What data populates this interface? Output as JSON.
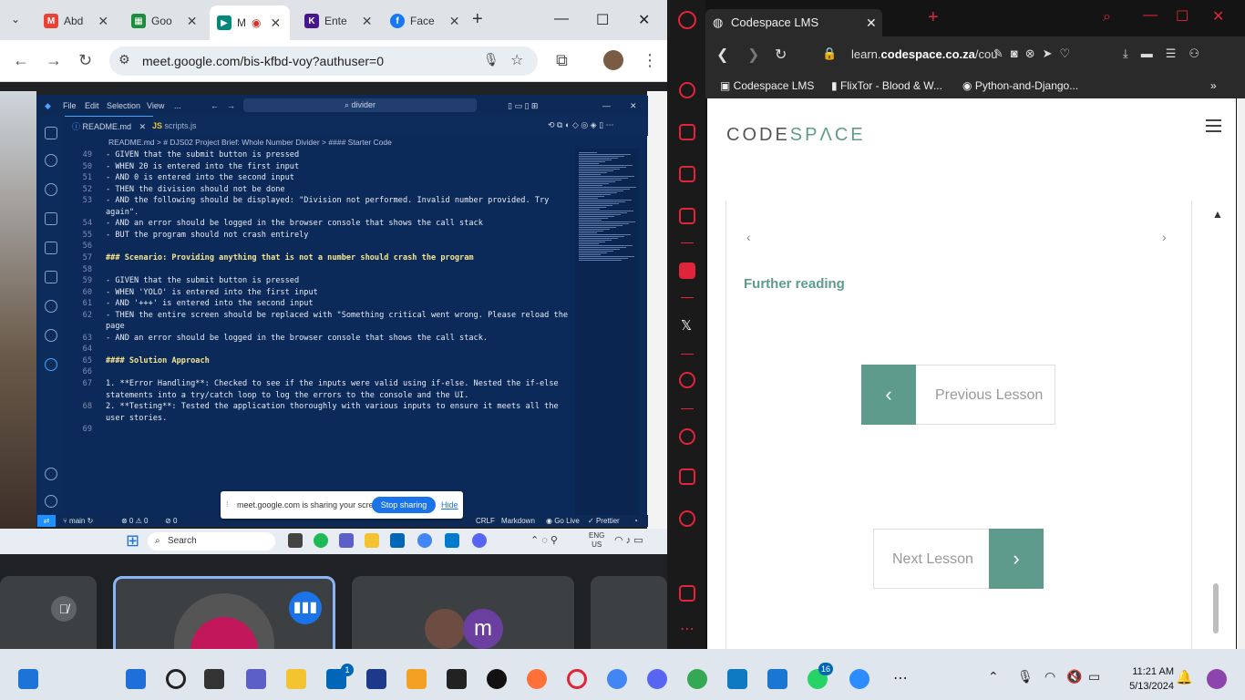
{
  "chrome": {
    "tabs": [
      {
        "label": "Abd",
        "icon": "gmail-icon",
        "color": "#ea4335"
      },
      {
        "label": "Goo",
        "icon": "google-sheets-icon",
        "color": "#1e8e3e"
      },
      {
        "label": "M",
        "icon": "google-meet-icon",
        "color": "#00897b"
      },
      {
        "label": "Ente",
        "icon": "kahoot-icon",
        "color": "#46178f"
      },
      {
        "label": "Face",
        "icon": "facebook-icon",
        "color": "#1877f2"
      }
    ],
    "url": "meet.google.com/bis-kfbd-voy?authuser=0"
  },
  "vscode": {
    "menu": [
      "File",
      "Edit",
      "Selection",
      "View",
      "..."
    ],
    "search": "divider",
    "tabs": [
      {
        "label": "README.md"
      },
      {
        "label": "scripts.js"
      }
    ],
    "breadcrumb": "README.md > # DJS02 Project Brief: Whole Number Divider > #### Starter Code",
    "lines": [
      {
        "n": "49",
        "text": "- GIVEN that the submit button is pressed",
        "h": false
      },
      {
        "n": "50",
        "text": "- WHEN 20 is entered into the first input",
        "h": false
      },
      {
        "n": "51",
        "text": "- AND 0 is entered into the second input",
        "h": false
      },
      {
        "n": "52",
        "text": "- THEN the division should not be done",
        "h": false
      },
      {
        "n": "53",
        "text": "- AND the following should be displayed: \"Division not performed. Invalid number provided. Try",
        "h": false
      },
      {
        "n": "",
        "text": "again\".",
        "h": false
      },
      {
        "n": "54",
        "text": "- AND an error should be logged in the browser console that shows the call stack",
        "h": false
      },
      {
        "n": "55",
        "text": "- BUT the program should not crash entirely",
        "h": false
      },
      {
        "n": "56",
        "text": "",
        "h": false
      },
      {
        "n": "57",
        "text": "### Scenario: Providing anything that is not a number should crash the program",
        "h": true
      },
      {
        "n": "58",
        "text": "",
        "h": false
      },
      {
        "n": "59",
        "text": "- GIVEN that the submit button is pressed",
        "h": false
      },
      {
        "n": "60",
        "text": "- WHEN 'YOLO' is entered into the first input",
        "h": false
      },
      {
        "n": "61",
        "text": "- AND '+++' is entered into the second input",
        "h": false
      },
      {
        "n": "62",
        "text": "- THEN the entire screen should be replaced with \"Something critical went wrong. Please reload the",
        "h": false
      },
      {
        "n": "",
        "text": "page",
        "h": false
      },
      {
        "n": "63",
        "text": "- AND an error should be logged in the browser console that shows the call stack.",
        "h": false
      },
      {
        "n": "64",
        "text": "",
        "h": false
      },
      {
        "n": "65",
        "text": "#### Solution Approach",
        "h": true
      },
      {
        "n": "66",
        "text": "",
        "h": false
      },
      {
        "n": "67",
        "text": "1. **Error Handling**: Checked to see if the inputs were valid using if-else. Nested the if-else",
        "h": false
      },
      {
        "n": "",
        "text": "statements into a try/catch loop to log the errors to the console and the UI.",
        "h": false
      },
      {
        "n": "68",
        "text": "2. **Testing**: Tested the application thoroughly with various inputs to ensure it meets all the",
        "h": false
      },
      {
        "n": "",
        "text": "user stories.",
        "h": false
      },
      {
        "n": "69",
        "text": "",
        "h": false
      }
    ],
    "status": {
      "branch": "main",
      "problems": "⊗ 0 ⚠ 0",
      "ports": "0",
      "eol": "CRLF",
      "language": "Markdown",
      "live": "Go Live",
      "prettier": "Prettier"
    }
  },
  "share_bar": {
    "text": "meet.google.com is sharing your screen.",
    "stop": "Stop sharing",
    "hide": "Hide"
  },
  "embedded_taskbar": {
    "search": "Search",
    "lang": "ENG",
    "region": "US"
  },
  "meet": {
    "participant_initial": "m"
  },
  "opera": {
    "tab_title": "Codespace LMS",
    "url_prefix": "learn.",
    "url_host": "codespace.co.za",
    "url_suffix": "/cou",
    "bookmarks": [
      "Codespace LMS",
      "FlixTor - Blood & W...",
      "Python-and-Django..."
    ]
  },
  "page": {
    "logo_a": "CODE",
    "logo_b": "SP",
    "logo_c": "Λ",
    "logo_d": "CE",
    "further_reading": "Further reading",
    "prev": "Previous Lesson",
    "next": "Next Lesson",
    "accent": "#5f9b8c"
  },
  "taskbar": {
    "time": "11:21 AM",
    "date": "5/13/2024",
    "badge_teams": "1",
    "badge_whatsapp": "16"
  }
}
